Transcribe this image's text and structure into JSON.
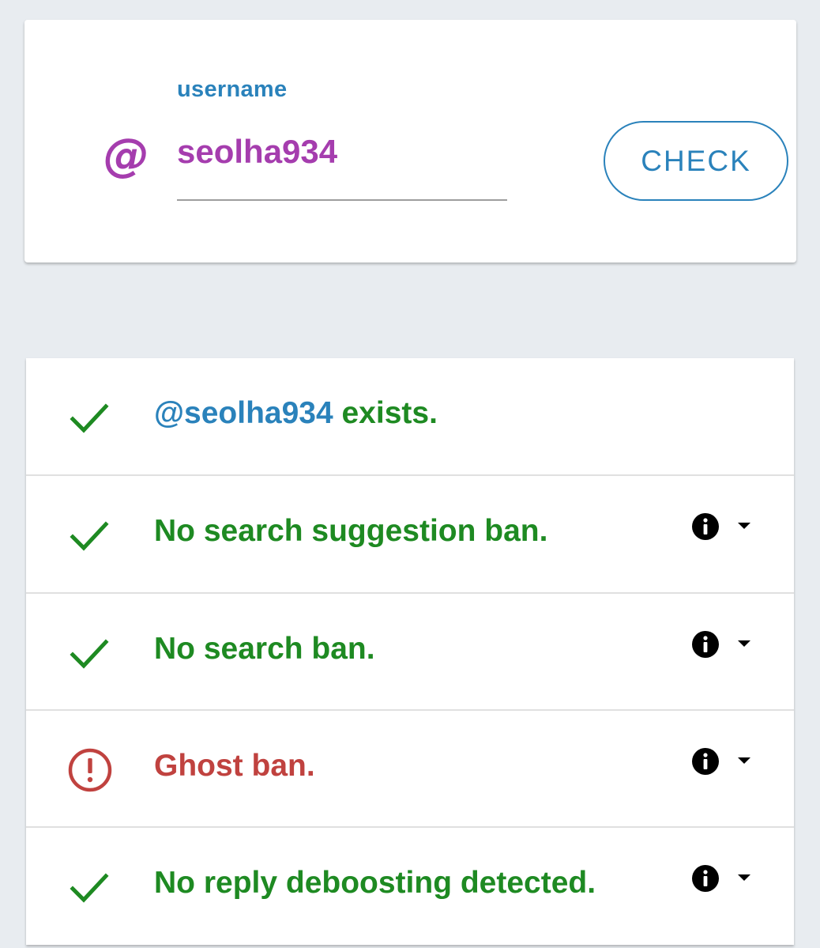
{
  "form": {
    "at_symbol": "@",
    "label": "username",
    "username_value": "seolha934",
    "check_label": "CHECK"
  },
  "results": [
    {
      "status": "ok",
      "mention": "@seolha934",
      "text": " exists.",
      "has_info": false
    },
    {
      "status": "ok",
      "text": "No search suggestion ban.",
      "has_info": true
    },
    {
      "status": "ok",
      "text": "No search ban.",
      "has_info": true
    },
    {
      "status": "alert",
      "text": "Ghost ban.",
      "has_info": true
    },
    {
      "status": "ok",
      "text": "No reply deboosting detected.",
      "has_info": true
    }
  ],
  "colors": {
    "background": "#e8ecf0",
    "accent_blue": "#2a82bb",
    "purple": "#a53dae",
    "ok_green": "#1e8a22",
    "alert_red": "#c0423f"
  },
  "icons": {
    "ok": "check-icon",
    "alert": "alert-circle-icon",
    "info": "info-icon",
    "expand": "caret-down-icon"
  }
}
